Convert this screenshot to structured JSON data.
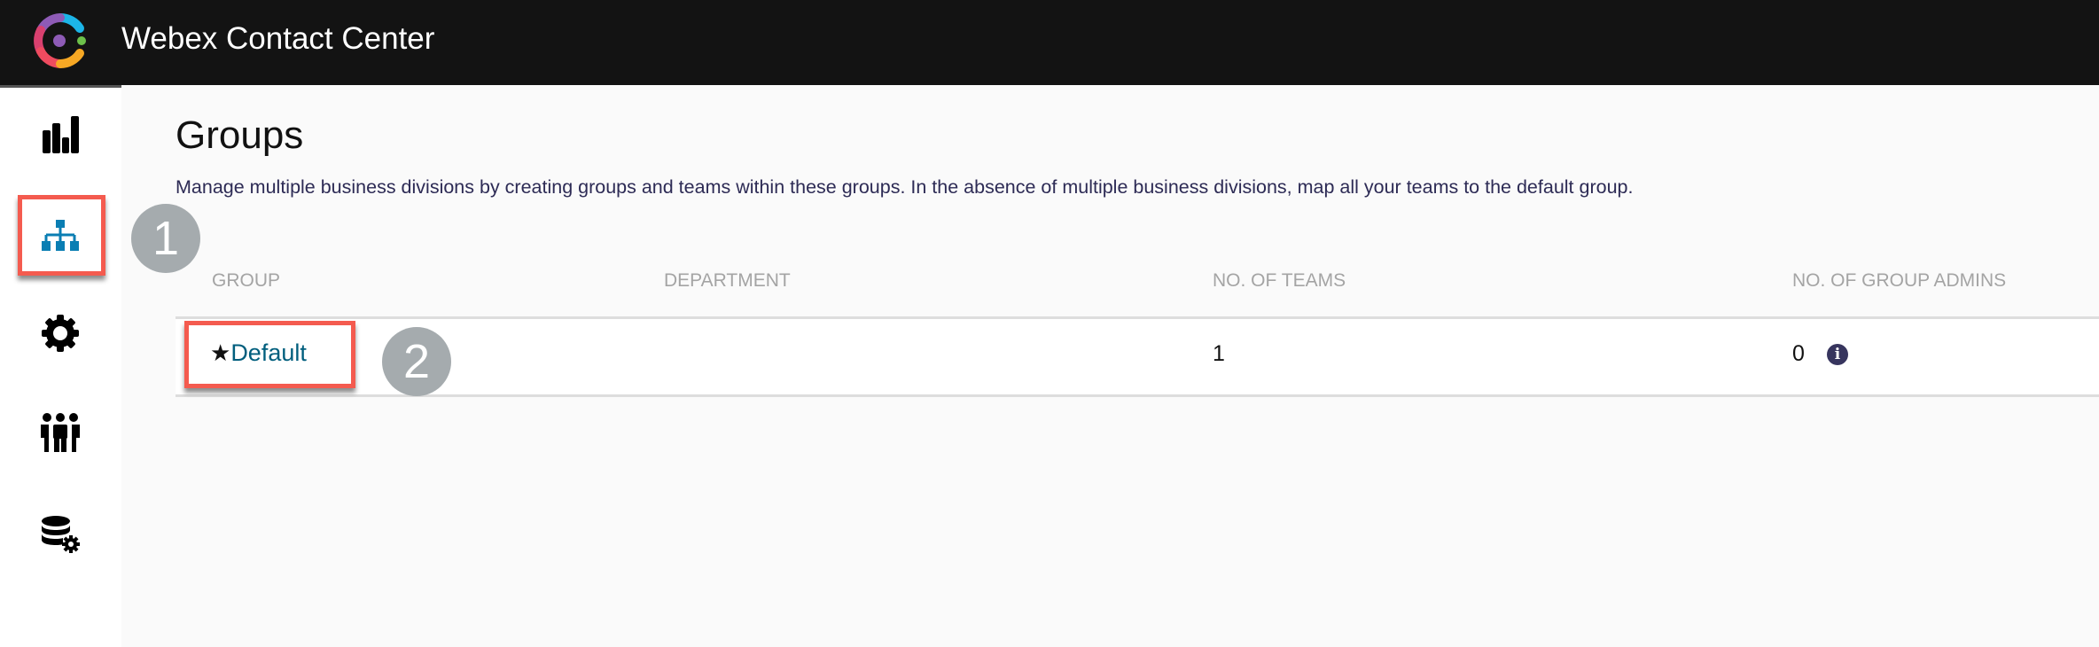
{
  "header": {
    "app_title": "Webex Contact Center",
    "logo": "webex-contact-center-logo"
  },
  "sidebar": {
    "items": [
      {
        "icon": "bar-chart-icon",
        "active": false
      },
      {
        "icon": "org-hierarchy-icon",
        "active": true,
        "color": "#0a7eb3"
      },
      {
        "icon": "gear-icon",
        "active": false
      },
      {
        "icon": "people-icon",
        "active": false
      },
      {
        "icon": "database-gear-icon",
        "active": false
      }
    ]
  },
  "main": {
    "title": "Groups",
    "description": "Manage multiple business divisions by creating groups and teams within these groups. In the absence of multiple business divisions, map all your teams to the default group.",
    "table": {
      "columns": [
        "GROUP",
        "DEPARTMENT",
        "NO. OF TEAMS",
        "NO. OF GROUP ADMINS"
      ],
      "rows": [
        {
          "group": "Default",
          "default_star": "★",
          "department": "",
          "teams": "1",
          "admins": "0",
          "admins_icon": "info-icon"
        }
      ]
    }
  },
  "annotations": {
    "step1": "1",
    "step2": "2",
    "highlight_color": "#f45b4f"
  }
}
